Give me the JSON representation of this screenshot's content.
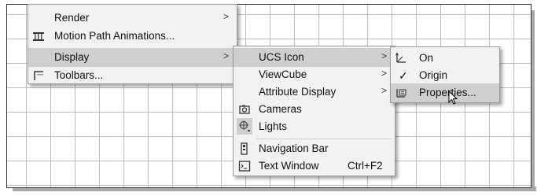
{
  "main_menu": {
    "items": [
      {
        "label": "Render",
        "icon": "",
        "submenu": true
      },
      {
        "label": "Motion Path Animations...",
        "icon": "motion-path-icon",
        "submenu": false
      },
      {
        "label": "Display",
        "icon": "",
        "submenu": true,
        "highlighted": true
      },
      {
        "label": "Toolbars...",
        "icon": "toolbars-icon",
        "submenu": false
      }
    ]
  },
  "display_menu": {
    "items": [
      {
        "label": "UCS Icon",
        "submenu": true,
        "highlighted": true
      },
      {
        "label": "ViewCube",
        "submenu": true
      },
      {
        "label": "Attribute Display",
        "submenu": true
      },
      {
        "label": "Cameras",
        "icon": "camera-icon"
      },
      {
        "label": "Lights",
        "icon": "lights-icon"
      },
      {
        "label": "Navigation Bar",
        "icon": "navigation-bar-icon"
      },
      {
        "label": "Text Window",
        "icon": "text-window-icon",
        "shortcut": "Ctrl+F2"
      }
    ]
  },
  "ucs_menu": {
    "items": [
      {
        "label": "On",
        "icon": "ucs-on-icon"
      },
      {
        "label": "Origin",
        "icon": "checkmark-icon",
        "checked": true
      },
      {
        "label": "Properties...",
        "icon": "ucs-properties-icon",
        "highlighted": true
      }
    ]
  },
  "glyphs": {
    "submenu_arrow": ">",
    "check": "✓"
  }
}
